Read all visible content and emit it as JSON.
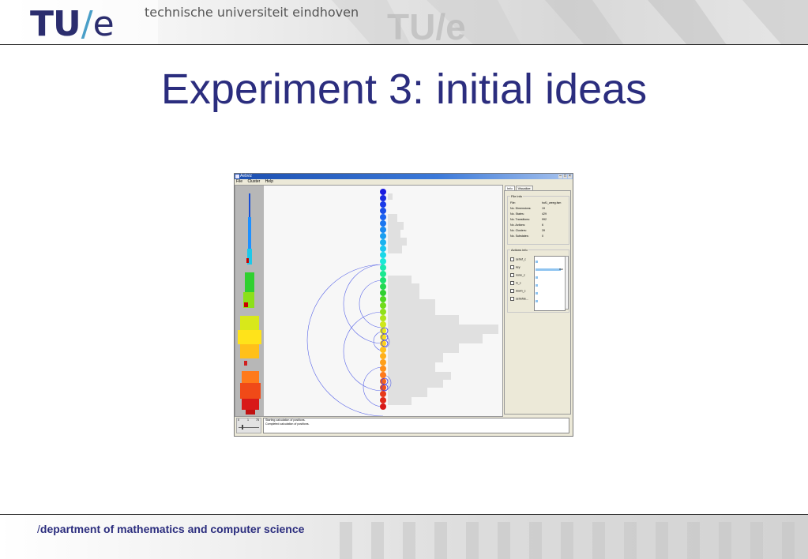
{
  "header": {
    "logo_tu": "TU",
    "logo_slash": "/",
    "logo_e": "e",
    "university": "technische universiteit eindhoven"
  },
  "slide": {
    "title": "Experiment 3: initial ideas"
  },
  "footer": {
    "slash": "/",
    "department": "department of mathematics and computer science"
  },
  "app": {
    "window_title": "Aebviz",
    "menu": [
      "File",
      "Cluster",
      "Help"
    ],
    "tabs": [
      "Info",
      "Visualize"
    ],
    "file_info": {
      "group_title": "File info",
      "rows": [
        {
          "label": "File:",
          "value": "hof1_weeg.fsm"
        },
        {
          "label": "No. Dimensions:",
          "value": "19"
        },
        {
          "label": "No. States:",
          "value": "429"
        },
        {
          "label": "No. Transitions:",
          "value": "992"
        },
        {
          "label": "No. Actions:",
          "value": "6"
        },
        {
          "label": "No. Clusters:",
          "value": "39"
        },
        {
          "label": "No. Substates:",
          "value": "0"
        }
      ]
    },
    "actions_info": {
      "group_title": "Actions info",
      "items": [
        "setref_c",
        "key",
        "none_c",
        "in_c",
        "down_c",
        "setrefde..."
      ],
      "bar_fractions": [
        0.1,
        0.95,
        0.1,
        0.1,
        0.1,
        0.1
      ],
      "bar_value_label": "992"
    },
    "log_lines": [
      "Starting calculation of positions.",
      "Completed calculation of positions."
    ],
    "slider_ticks": [
      "0",
      "1",
      "75"
    ]
  },
  "colors": {
    "title": "#2b2d7e",
    "logo": "#2b2d6e",
    "logo_slash": "#4a9fc8"
  }
}
